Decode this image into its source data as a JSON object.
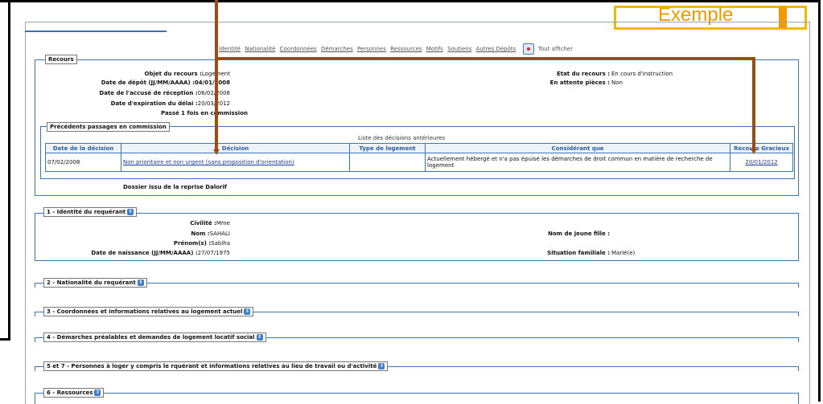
{
  "example_label": "Exemple",
  "nav": {
    "links": [
      "Identité",
      "Nationalité",
      "Coordonnées",
      "Démarches",
      "Personnes",
      "Ressources",
      "Motifs",
      "Soutiens",
      "Autres Dépôts"
    ],
    "show_all": "Tout afficher",
    "show_all_icon": "eye-icon"
  },
  "recours": {
    "legend": "Recours",
    "objet_label": "Objet du recours :",
    "objet_value": "Logement",
    "depot_label": "Date de dépôt (JJ/MM/AAAA) :",
    "depot_value": "04/01/2008",
    "accuse_label": "Date de l'accusé de réception :",
    "accuse_value": "06/02/2008",
    "expiration_label": "Date d'expiration du délai :",
    "expiration_value": "20/03/2012",
    "passe_text": "Passé 1 fois en commission",
    "etat_label": "Etat du recours :",
    "etat_value": "En cours d'instruction",
    "attente_label": "En attente pièces :",
    "attente_value": "Non",
    "dossier_text": "Dossier issu de la reprise Dalorif"
  },
  "passages": {
    "legend": "Précédents passages en commission",
    "caption": "Liste des décisions antérieures",
    "headers": [
      "Date de la décision",
      "Décision",
      "Type de logement",
      "Considérant que",
      "Recours Gracieux"
    ],
    "rows": [
      {
        "date": "07/02/2008",
        "decision": "Non prioritaire et non urgent (sans proposition d'orientation)",
        "type": "",
        "considerant": "Actuellement hébergé et n'a pas épuisé les démarches de droit commun en matière de recherche de logement",
        "recours": "20/01/2012"
      }
    ]
  },
  "identite": {
    "legend": "1 - Identité du requérant",
    "civilite_label": "Civilité :",
    "civilite_value": "Mme",
    "nom_label": "Nom :",
    "nom_value": "SAHALI",
    "prenom_label": "Prénom(s) :",
    "prenom_value": "Sabiha",
    "naissance_label": "Date de naissance (JJ/MM/AAAA) :",
    "naissance_value": "27/07/1975",
    "jeune_fille_label": "Nom de jeune fille :",
    "jeune_fille_value": "",
    "situation_label": "Situation familiale :",
    "situation_value": "Marié(e)"
  },
  "sections": [
    "2 - Nationalité du requérant",
    "3 - Coordonnées et informations relatives au logement actuel",
    "4 - Démarches préalables et demandes de logement locatif social",
    "5 et 7 - Personnes à loger y compris le rquérant et informations relatives au lieu de travail ou d'activité",
    "6 - Ressources"
  ],
  "colors": {
    "accent": "#3b76b5",
    "annotation_arrow": "#9c4e12",
    "example_frame": "#f5b800"
  }
}
